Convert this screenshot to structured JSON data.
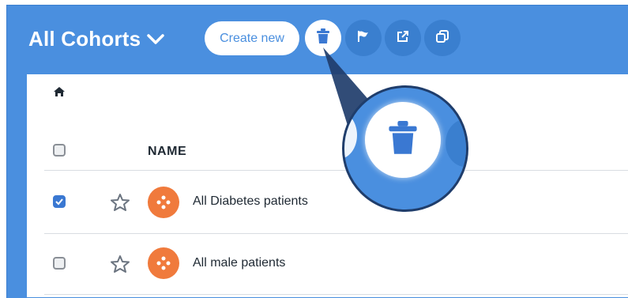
{
  "header": {
    "title": "All Cohorts",
    "create_label": "Create new",
    "toolbar_icons": [
      "trash-icon",
      "flag-icon",
      "share-icon",
      "copy-icon"
    ]
  },
  "breadcrumb": {
    "icon": "home-icon"
  },
  "table": {
    "columns": [
      "NAME"
    ],
    "rows": [
      {
        "name": "All Diabetes patients",
        "checked": true
      },
      {
        "name": "All male patients",
        "checked": false
      }
    ]
  },
  "colors": {
    "brand_blue": "#4a8fdf",
    "toolbar_button": "#3a7fcf",
    "cohort_icon": "#f07a3c",
    "checkbox_checked": "#3a78d2"
  }
}
